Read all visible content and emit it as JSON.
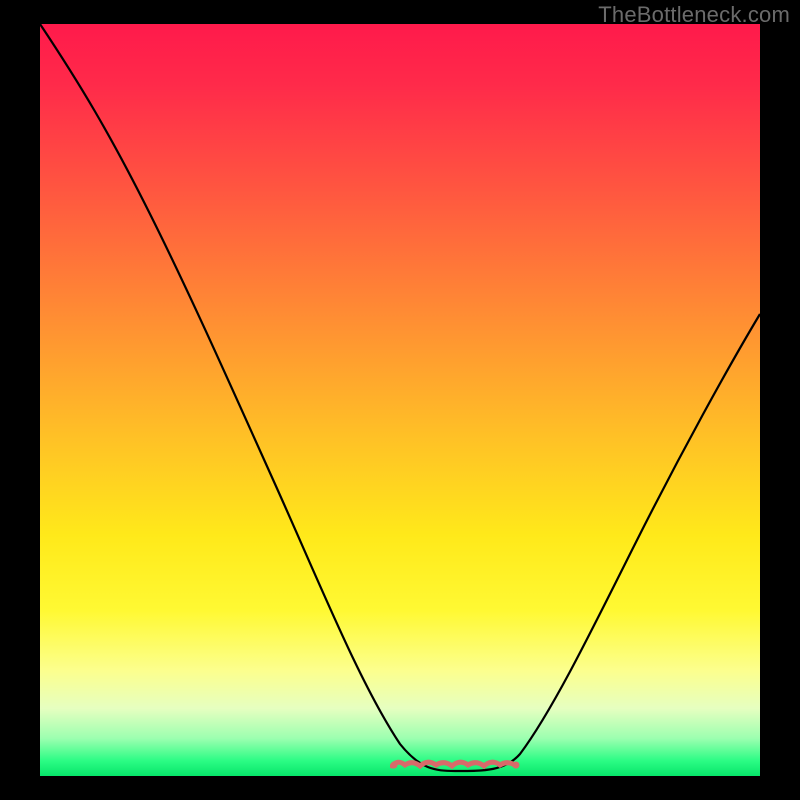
{
  "watermark": "TheBottleneck.com",
  "colors": {
    "frame": "#000000",
    "curve": "#000000",
    "ridge": "#d86a6a",
    "gradient_stops": [
      "#ff1a4b",
      "#ff5640",
      "#ffc126",
      "#fff933",
      "#2bfc84"
    ]
  },
  "chart_data": {
    "type": "line",
    "title": "",
    "xlabel": "",
    "ylabel": "",
    "xlim": [
      0,
      100
    ],
    "ylim": [
      0,
      100
    ],
    "series": [
      {
        "name": "bottleneck-curve",
        "x": [
          0,
          6,
          12,
          18,
          24,
          30,
          36,
          42,
          48,
          52,
          56,
          60,
          64,
          68,
          72,
          78,
          85,
          92,
          100
        ],
        "y": [
          100,
          93,
          84,
          74,
          63,
          51,
          39,
          27,
          15,
          8,
          3,
          1,
          1,
          2,
          6,
          14,
          26,
          40,
          56
        ]
      }
    ],
    "annotation": {
      "name": "optimal-range-ridge",
      "x_range": [
        50,
        67
      ],
      "y": 1
    }
  }
}
